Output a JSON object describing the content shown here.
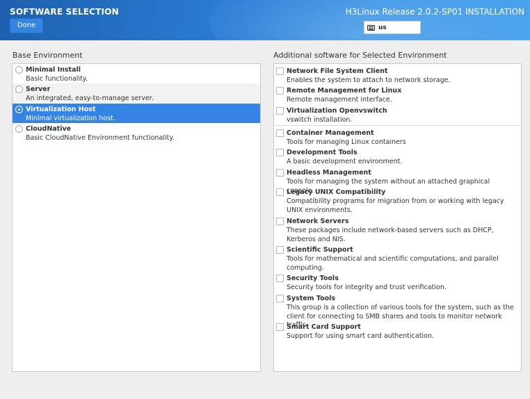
{
  "header": {
    "page_title": "SOFTWARE SELECTION",
    "product_title": "H3Linux Release 2.0.2-SP01 INSTALLATION",
    "done_label": "Done",
    "keyboard_layout": "us",
    "accent_color": "#3584e4"
  },
  "base_environment": {
    "label": "Base Environment",
    "items": [
      {
        "title": "Minimal Install",
        "desc": "Basic functionality."
      },
      {
        "title": "Server",
        "desc": "An integrated, easy-to-manage server."
      },
      {
        "title": "Virtualization Host",
        "desc": "Minimal virtualization host."
      },
      {
        "title": "CloudNative",
        "desc": "Basic CloudNative Environment functionality."
      }
    ],
    "selected_index": 2
  },
  "additional_software": {
    "label": "Additional software for Selected Environment",
    "items": [
      {
        "title": "Network File System Client",
        "desc": "Enables the system to attach to network storage."
      },
      {
        "title": "Remote Management for Linux",
        "desc": "Remote management interface."
      },
      {
        "title": "Virtualization Openvswitch",
        "desc": "vswitch installation."
      },
      {
        "title": "Container Management",
        "desc": "Tools for managing Linux containers"
      },
      {
        "title": "Development Tools",
        "desc": "A basic development environment."
      },
      {
        "title": "Headless Management",
        "desc": "Tools for managing the system without an attached graphical console."
      },
      {
        "title": "Legacy UNIX Compatibility",
        "desc": "Compatibility programs for migration from or working with legacy UNIX environments."
      },
      {
        "title": "Network Servers",
        "desc": "These packages include network-based servers such as DHCP, Kerberos and NIS."
      },
      {
        "title": "Scientific Support",
        "desc": "Tools for mathematical and scientific computations, and parallel computing."
      },
      {
        "title": "Security Tools",
        "desc": "Security tools for integrity and trust verification."
      },
      {
        "title": "System Tools",
        "desc": "This group is a collection of various tools for the system, such as the client for connecting to SMB shares and tools to monitor network traffic."
      },
      {
        "title": "Smart Card Support",
        "desc": "Support for using smart card authentication."
      }
    ]
  }
}
